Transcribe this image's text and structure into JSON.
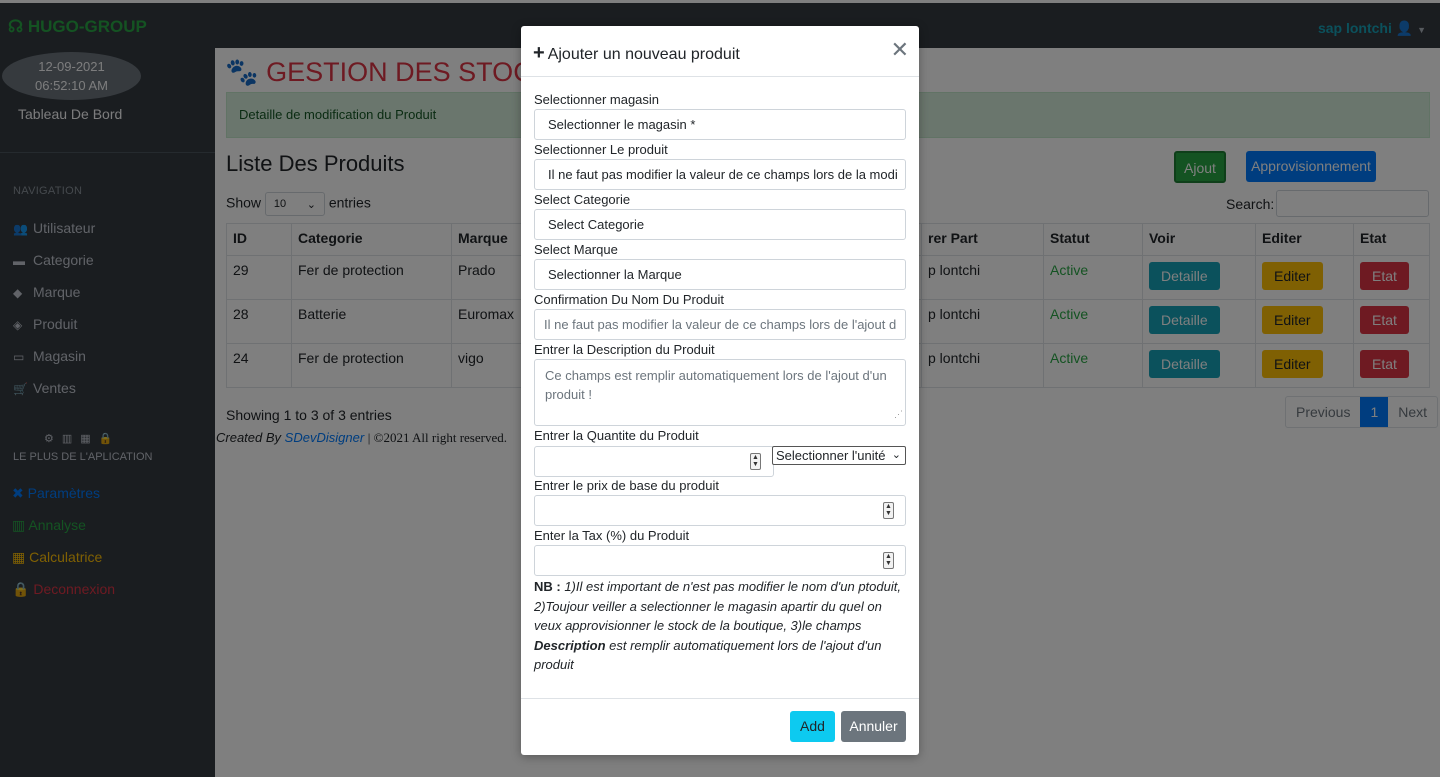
{
  "topbar": {
    "brand": "HUGO-GROUP",
    "user": "sap lontchi"
  },
  "sidebar": {
    "date": "12-09-2021",
    "time": "06:52:10 AM",
    "dashboard": "Tableau De Bord",
    "nav_heading": "NAVIGATION",
    "items": [
      {
        "label": "Utilisateur",
        "icon": "users-icon"
      },
      {
        "label": "Categorie",
        "icon": "briefcase-icon"
      },
      {
        "label": "Marque",
        "icon": "tag-icon"
      },
      {
        "label": "Produit",
        "icon": "tags-icon"
      },
      {
        "label": "Magasin",
        "icon": "store-icon"
      },
      {
        "label": "Ventes",
        "icon": "cart-icon"
      }
    ],
    "subheading": "LE PLUS DE L'APLICATION",
    "links": [
      {
        "label": "Paramètres",
        "color": "#007bff"
      },
      {
        "label": "Annalyse",
        "color": "#28a745"
      },
      {
        "label": "Calculatrice",
        "color": "#ffc107"
      },
      {
        "label": "Deconnexion",
        "color": "#dc3545"
      }
    ]
  },
  "main": {
    "title": "GESTION DES STOCK",
    "alert": "Detaille de modification du Produit",
    "list_title": "Liste Des Produits",
    "ajout_btn": "Ajout",
    "appro_btn": "Approvisionnement",
    "show": "Show",
    "show_value": "10",
    "entries": "entries",
    "search": "Search:",
    "columns": [
      "ID",
      "Categorie",
      "Marque",
      "rer Part",
      "Statut",
      "Voir",
      "Editer",
      "Etat"
    ],
    "rows": [
      {
        "id": "29",
        "categorie": "Fer de protection",
        "marque": "Prado",
        "part": "p lontchi",
        "statut": "Active"
      },
      {
        "id": "28",
        "categorie": "Batterie",
        "marque": "Euromax",
        "part": "p lontchi",
        "statut": "Active"
      },
      {
        "id": "24",
        "categorie": "Fer de protection",
        "marque": "vigo",
        "part": "p lontchi",
        "statut": "Active"
      }
    ],
    "row_buttons": {
      "detail": "Detaille",
      "edit": "Editer",
      "etat": "Etat"
    },
    "showing": "Showing 1 to 3 of 3 entries",
    "credits_prefix": "Created By",
    "credits_link": "SDevDisigner",
    "credits_suffix": "| ©2021 All right reserved.",
    "pager": {
      "prev": "Previous",
      "page": "1",
      "next": "Next"
    }
  },
  "modal": {
    "title": "Ajouter un nouveau produit",
    "magasin_label": "Selectionner magasin",
    "magasin_value": "Selectionner le magasin *",
    "produit_label": "Selectionner Le produit",
    "produit_value": "Il ne faut pas modifier la valeur de ce champs lors de la modi",
    "categorie_label": "Select Categorie",
    "categorie_value": "Select Categorie",
    "marque_label": "Select Marque",
    "marque_value": "Selectionner la Marque",
    "confirm_label": "Confirmation Du Nom Du Produit",
    "confirm_placeholder": "Il ne faut pas modifier la valeur de ce champs lors de l'ajout d",
    "desc_label": "Entrer la Description du Produit",
    "desc_placeholder": "Ce champs est remplir automatiquement lors de l'ajout d'un produit !",
    "qty_label": "Entrer la Quantite du Produit",
    "unit_value": "Selectionner l'unité",
    "price_label": "Entrer le prix de base du produit",
    "tax_label": "Enter la Tax (%) du Produit",
    "nb_bold": "NB :",
    "nb_text": " 1)Il est important de n'est pas modifier le nom d'un ptoduit, 2)Toujour veiller a selectionner le magasin apartir du quel on veux approvisionner le stock de la boutique, 3)le champs ",
    "nb_desc_bold": "Description",
    "nb_text2": " est remplir automatiquement lors de l'ajout d'un produit",
    "add_btn": "Add",
    "cancel_btn": "Annuler"
  }
}
